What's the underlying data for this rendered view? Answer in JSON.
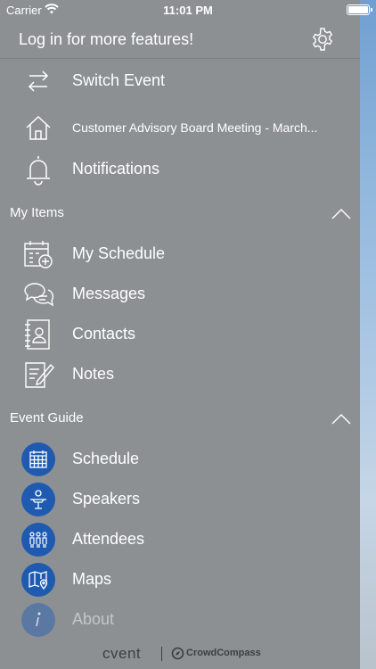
{
  "status_bar": {
    "carrier": "Carrier",
    "time": "11:01 PM"
  },
  "header": {
    "login_text": "Log in for more features!"
  },
  "top_items": [
    {
      "label": "Switch Event",
      "icon": "switch-arrows-icon"
    },
    {
      "label": "Customer Advisory Board Meeting - March...",
      "icon": "home-icon"
    },
    {
      "label": "Notifications",
      "icon": "bell-icon"
    }
  ],
  "my_items": {
    "title": "My Items",
    "items": [
      {
        "label": "My Schedule",
        "icon": "calendar-add-icon"
      },
      {
        "label": "Messages",
        "icon": "chat-bubbles-icon"
      },
      {
        "label": "Contacts",
        "icon": "contact-book-icon"
      },
      {
        "label": "Notes",
        "icon": "notepad-icon"
      }
    ]
  },
  "event_guide": {
    "title": "Event Guide",
    "items": [
      {
        "label": "Schedule",
        "icon": "calendar-grid-icon"
      },
      {
        "label": "Speakers",
        "icon": "speaker-podium-icon"
      },
      {
        "label": "Attendees",
        "icon": "attendees-group-icon"
      },
      {
        "label": "Maps",
        "icon": "map-pin-icon"
      },
      {
        "label": "About",
        "icon": "info-icon"
      }
    ]
  },
  "footer": {
    "brand": "cvent",
    "product": "CrowdCompass"
  },
  "colors": {
    "panel": "#8d9093",
    "accent_circle": "#1e5bb0",
    "text": "#ffffff",
    "footer_text": "#3c3f42"
  }
}
